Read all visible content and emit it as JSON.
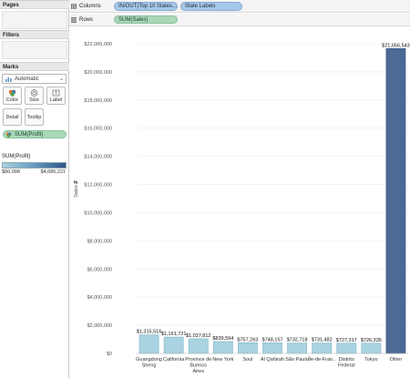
{
  "panes": {
    "pages_title": "Pages",
    "filters_title": "Filters",
    "marks_title": "Marks",
    "mark_type": "Automatic",
    "mark_buttons": [
      "Color",
      "Size",
      "Label",
      "Detail",
      "Tooltip"
    ],
    "color_pill": "SUM(Profit)"
  },
  "legend": {
    "title": "SUM(Profit)",
    "min": "$86,098",
    "max": "$4,686,221"
  },
  "shelves": {
    "columns_label": "Columns",
    "rows_label": "Rows",
    "columns_pills": [
      "IN/OUT(Top 10 States...",
      "State Labels"
    ],
    "rows_pill": "SUM(Sales)"
  },
  "chart_data": {
    "type": "bar",
    "ylabel": "Sales",
    "ylim": [
      0,
      22000000
    ],
    "y_ticks": [
      "$0",
      "$2,000,000",
      "$4,000,000",
      "$6,000,000",
      "$8,000,000",
      "$10,000,000",
      "$12,000,000",
      "$14,000,000",
      "$16,000,000",
      "$18,000,000",
      "$20,000,000",
      "$22,000,000"
    ],
    "y_tick_values": [
      0,
      2000000,
      4000000,
      6000000,
      8000000,
      10000000,
      12000000,
      14000000,
      16000000,
      18000000,
      20000000,
      22000000
    ],
    "categories": [
      [
        "Guangdong",
        "Sheng"
      ],
      [
        "California"
      ],
      [
        "Province de",
        "Buenos",
        "Aires"
      ],
      [
        "New York"
      ],
      [
        "Soul"
      ],
      [
        "Al Qahirah"
      ],
      [
        "São Paulo"
      ],
      [
        "Île-de-Fran.."
      ],
      [
        "Distrito",
        "Federal"
      ],
      [
        "Tokyo"
      ],
      [
        "Other"
      ]
    ],
    "values": [
      1315516,
      1161721,
      1037812,
      839594,
      757263,
      748157,
      732718,
      731482,
      727317,
      726335,
      21656543
    ],
    "value_labels": [
      "$1,315,516",
      "$1,161,721",
      "$1,037,812",
      "$839,594",
      "$757,263",
      "$748,157",
      "$732,718",
      "$731,482",
      "$727,317",
      "$726,335",
      "$21,656,543"
    ],
    "colors": {
      "top10": "#a9d3e0",
      "top10_stroke": "#7fb2c6",
      "other": "#4b6a95",
      "other_stroke": "#3a5680",
      "gridline": "#eeeeee"
    }
  }
}
